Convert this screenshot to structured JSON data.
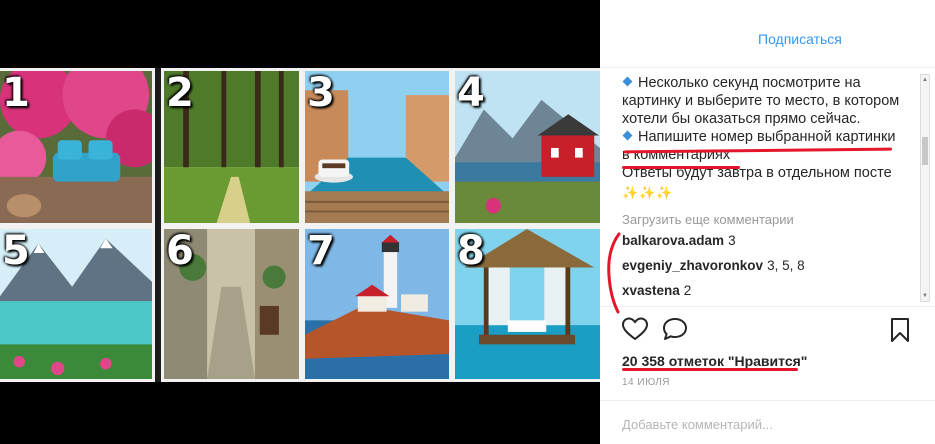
{
  "photo": {
    "tiles": [
      {
        "number": "1"
      },
      {
        "number": "2"
      },
      {
        "number": "3"
      },
      {
        "number": "4"
      },
      {
        "number": "5"
      },
      {
        "number": "6"
      },
      {
        "number": "7"
      },
      {
        "number": "8"
      }
    ]
  },
  "header": {
    "follow_label": "Подписаться"
  },
  "caption": {
    "line1": "Несколько секунд посмотрите на",
    "line2": "картинку и выберите то место, в котором",
    "line3": "хотели бы оказаться прямо сейчас.",
    "line4": "Напишите номер выбранной картинки",
    "line5": "в комментариях",
    "line6": "Ответы будут завтра в отдельном посте",
    "bullet_icon": "blue-diamond",
    "emoji_icon": "sparkles"
  },
  "load_more_label": "Загрузить еще комментарии",
  "comments": [
    {
      "user": "balkarova.adam",
      "text": "3"
    },
    {
      "user": "evgeniy_zhavoronkov",
      "text": "3, 5, 8"
    },
    {
      "user": "xvastena",
      "text": "2"
    }
  ],
  "actions": {
    "like_icon": "heart-outline",
    "comment_icon": "speech-bubble",
    "save_icon": "bookmark"
  },
  "likes_text": "20 358 отметок \"Нравится\"",
  "date_text": "14 ИЮЛЯ",
  "add_comment": {
    "placeholder": "Добавьте комментарий..."
  },
  "colors": {
    "accent": "#3897f0",
    "annotation_red": "#e4162b",
    "text": "#262626",
    "muted": "#999999"
  }
}
